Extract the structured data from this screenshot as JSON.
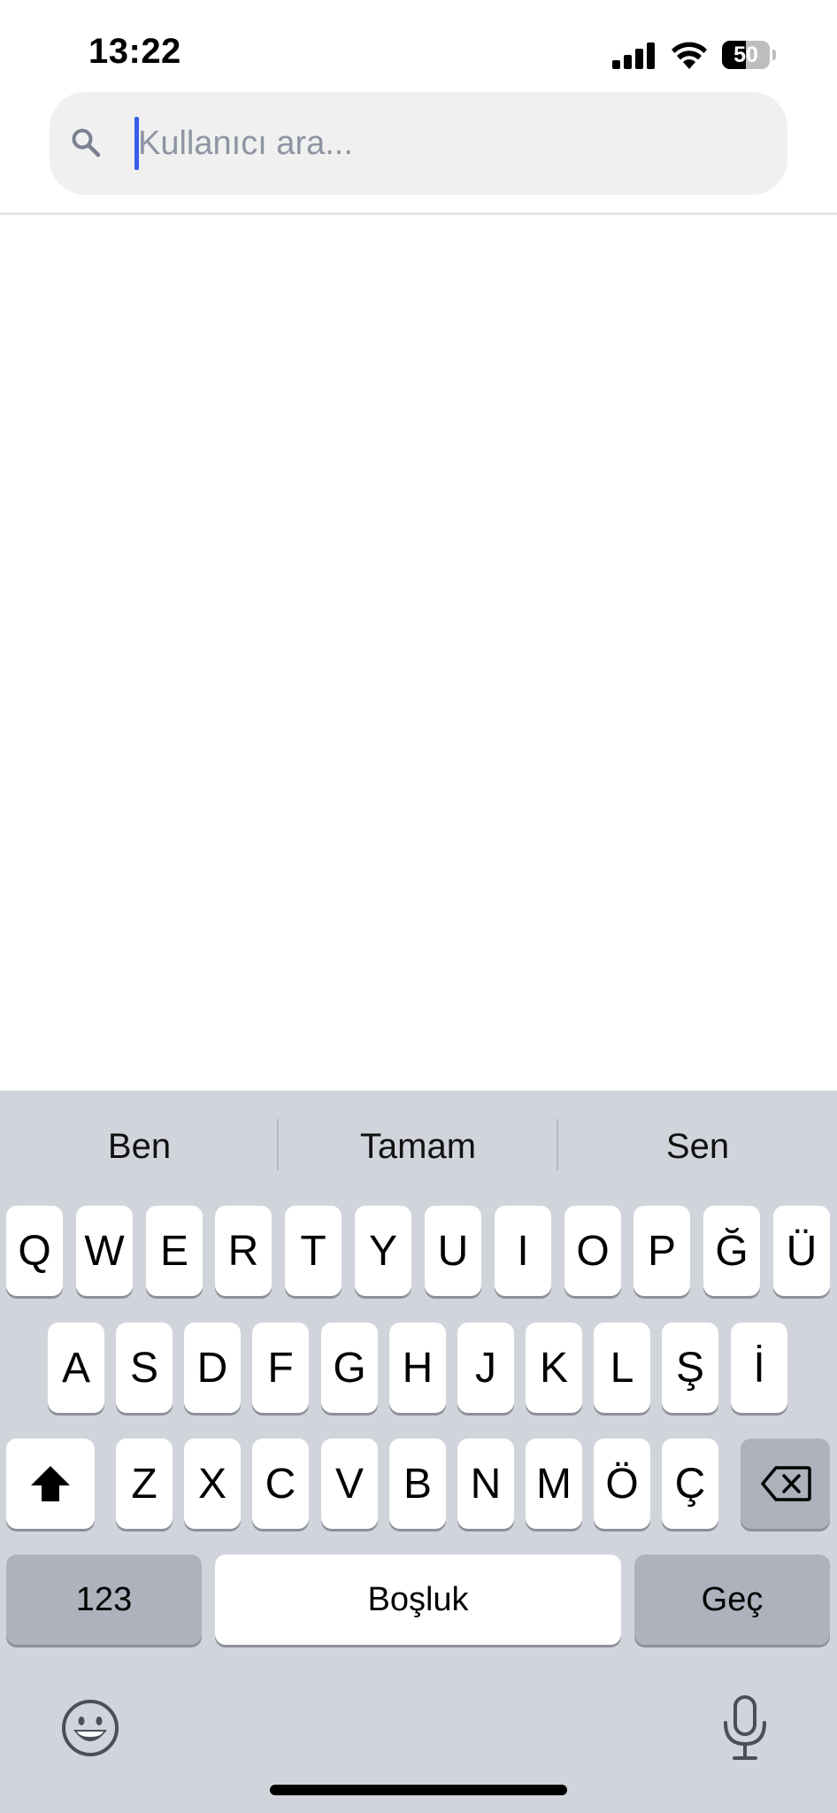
{
  "status_bar": {
    "time": "13:22",
    "battery_level": "50",
    "battery_fraction": 0.5
  },
  "search": {
    "placeholder": "Kullanıcı ara...",
    "value": ""
  },
  "keyboard": {
    "suggestions": [
      "Ben",
      "Tamam",
      "Sen"
    ],
    "row1": [
      "Q",
      "W",
      "E",
      "R",
      "T",
      "Y",
      "U",
      "I",
      "O",
      "P",
      "Ğ",
      "Ü"
    ],
    "row2": [
      "A",
      "S",
      "D",
      "F",
      "G",
      "H",
      "J",
      "K",
      "L",
      "Ş",
      "İ"
    ],
    "row3": [
      "Z",
      "X",
      "C",
      "V",
      "B",
      "N",
      "M",
      "Ö",
      "Ç"
    ],
    "numbers_label": "123",
    "space_label": "Boşluk",
    "return_label": "Geç",
    "icons": [
      "shift-icon",
      "backspace-icon",
      "emoji-icon",
      "microphone-icon",
      "search-icon"
    ]
  },
  "colors": {
    "accent_caret": "#3a5ae8",
    "keyboard_bg": "#d1d4db",
    "search_bg": "#f0f0f0"
  }
}
